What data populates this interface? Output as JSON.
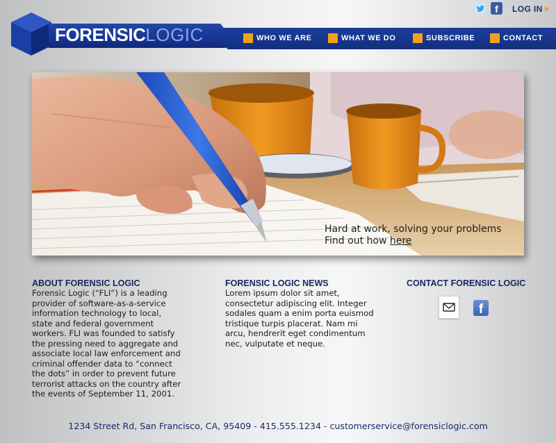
{
  "header": {
    "logo": {
      "word1": "FORENSIC",
      "word2": "LOGIC"
    },
    "nav": [
      {
        "label": "WHO WE ARE"
      },
      {
        "label": "WHAT WE DO"
      },
      {
        "label": "SUBSCRIBE"
      },
      {
        "label": "CONTACT"
      }
    ],
    "social": {
      "twitter_icon": "twitter-icon",
      "facebook_icon": "facebook-icon"
    },
    "login_label": "LOG IN",
    "accent_color": "#f4a11a",
    "brand_color": "#173595"
  },
  "hero": {
    "line1": "Hard at work, solving your problems",
    "line2_prefix": "Find out how ",
    "line2_link": "here"
  },
  "about": {
    "title": "ABOUT FORENSIC LOGIC",
    "lines": [
      "Forensic Logic (“FLI”) is a leading",
      "provider of software-as-a-service",
      "information technology to local,",
      "state and federal government",
      "workers.  FLI was founded to satisfy",
      "the pressing need to aggregate and",
      "associate local law enforcement and",
      "criminal offender data to “connect",
      "the dots” in order to prevent future",
      "terrorist attacks on the country after",
      "the events of September 11, 2001."
    ]
  },
  "news": {
    "title": "FORENSIC LOGIC NEWS",
    "lines": [
      "Lorem ipsum dolor sit amet,",
      "consectetur adipiscing elit. Integer",
      "sodales quam a enim porta euismod",
      "tristique turpis placerat. Nam mi",
      "arcu, hendrerit eget condimentum",
      "nec, vulputate et neque."
    ]
  },
  "contact": {
    "title": "CONTACT FORENSIC LOGIC",
    "icons": [
      "mail-icon",
      "facebook-icon"
    ]
  },
  "footer": {
    "text": "1234 Street Rd, San Francisco, CA, 95409 - 415.555.1234 - customerservice@forensiclogic.com"
  }
}
